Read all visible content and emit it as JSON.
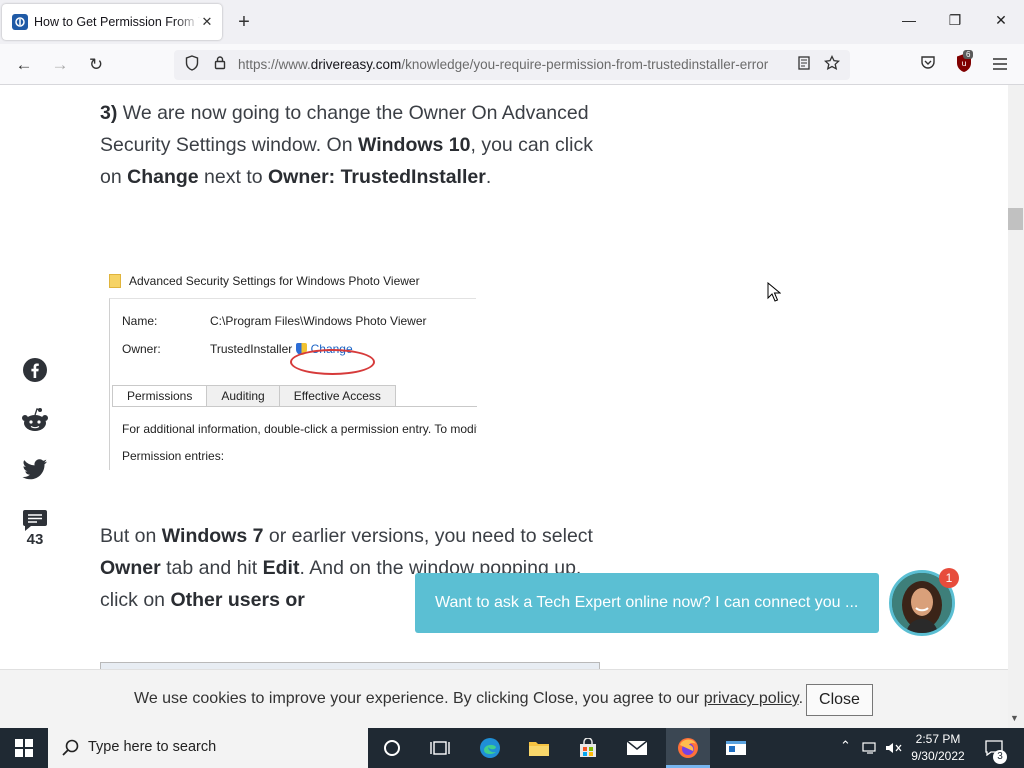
{
  "browser": {
    "tab_title": "How to Get Permission From TrustedInstaller",
    "tab_close": "✕",
    "new_tab": "+",
    "window_controls": {
      "minimize": "—",
      "restore": "❐",
      "close": "✕"
    },
    "nav": {
      "back": "←",
      "forward": "→",
      "reload": "↻"
    },
    "url_prefix": "https://www.",
    "url_host": "drivereasy.com",
    "url_path": "/knowledge/you-require-permission-from-trustedinstaller-error",
    "extension_badge": "6"
  },
  "article": {
    "step3": {
      "num": "3)",
      "t1": " We are now going to change the Owner On Advanced Security Settings window. On ",
      "b1": "Windows 10",
      "t2": ", you can click on ",
      "b2": "Change",
      "t3": " next to ",
      "b3": "Owner: TrustedInstaller",
      "t4": "."
    },
    "screenshot": {
      "title": "Advanced Security Settings for Windows Photo Viewer",
      "name_label": "Name:",
      "name_value": "C:\\Program Files\\Windows Photo Viewer",
      "owner_label": "Owner:",
      "owner_value": "TrustedInstaller",
      "change_link": "Change",
      "tabs": [
        "Permissions",
        "Auditing",
        "Effective Access"
      ],
      "info": "For additional information, double-click a permission entry. To modify a permission entry",
      "entries_label": "Permission entries:"
    },
    "win7": {
      "t1": "But on ",
      "b1": "Windows 7",
      "t2": " or earlier versions, you need to select ",
      "b2": "Owner",
      "t3": " tab and hit ",
      "b3": "Edit",
      "t4": ". And on the window popping up, click on ",
      "b4": "Other users or"
    }
  },
  "social": {
    "comment_count": "43"
  },
  "chat": {
    "message": "Want to ask a Tech Expert online now? I can connect you ...",
    "badge": "1"
  },
  "cookie": {
    "text_before": "We use cookies to improve your experience. By clicking Close, you agree to our ",
    "link": "privacy policy",
    "text_after": ".",
    "close_label": "Close"
  },
  "taskbar": {
    "search_placeholder": "Type here to search",
    "time": "2:57 PM",
    "date": "9/30/2022",
    "notification_count": "3"
  },
  "colors": {
    "chat_accent": "#5bbfd3",
    "taskbar": "#1f2933",
    "link": "#1b63c6"
  }
}
